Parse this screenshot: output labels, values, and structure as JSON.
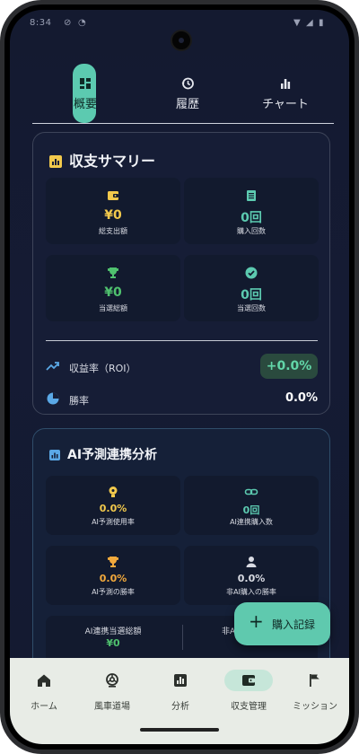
{
  "status": {
    "time": "8:34"
  },
  "tabs": [
    {
      "label": "概要",
      "icon": "dashboard-icon",
      "active": true
    },
    {
      "label": "履歴",
      "icon": "history-icon",
      "active": false
    },
    {
      "label": "チャート",
      "icon": "bar-chart-icon",
      "active": false
    }
  ],
  "summary": {
    "title": "収支サマリー",
    "tiles": [
      {
        "value": "¥0",
        "label": "総支出額",
        "icon": "wallet-icon",
        "color": "#f2c94c"
      },
      {
        "value": "0回",
        "label": "購入回数",
        "icon": "receipt-icon",
        "color": "#5ccab0"
      },
      {
        "value": "¥0",
        "label": "当選総額",
        "icon": "trophy-icon",
        "color": "#4fc16e"
      },
      {
        "value": "0回",
        "label": "当選回数",
        "icon": "check-circle-icon",
        "color": "#5ccab0"
      }
    ],
    "roi": {
      "label": "収益率（ROI）",
      "value": "+0.0%"
    },
    "win_rate": {
      "label": "勝率",
      "value": "0.0%"
    }
  },
  "ai": {
    "title": "AI予測連携分析",
    "tiles": [
      {
        "value": "0.0%",
        "label": "AI予測使用率",
        "icon": "lightbulb-icon",
        "color": "#f2c94c"
      },
      {
        "value": "0回",
        "label": "AI連携購入数",
        "icon": "link-icon",
        "color": "#5ccab0"
      },
      {
        "value": "0.0%",
        "label": "AI予測の勝率",
        "icon": "trophy-icon",
        "color": "#f2a93c"
      },
      {
        "value": "0.0%",
        "label": "非AI購入の勝率",
        "icon": "person-icon",
        "color": "#d9dbe3"
      }
    ],
    "bottom_left": {
      "label": "AI連携当選総額",
      "value": "¥0"
    },
    "bottom_right_partial": "非A"
  },
  "fab": {
    "label": "購入記録"
  },
  "nav": [
    {
      "label": "ホーム",
      "icon": "home-icon",
      "active": false
    },
    {
      "label": "風車道場",
      "icon": "pinwheel-icon",
      "active": false
    },
    {
      "label": "分析",
      "icon": "analytics-icon",
      "active": false
    },
    {
      "label": "収支管理",
      "icon": "wallet-icon",
      "active": true
    },
    {
      "label": "ミッション",
      "icon": "flag-icon",
      "active": false
    }
  ],
  "colors": {
    "accent": "#5ccab0",
    "yellow": "#f2c94c",
    "green": "#4fc16e",
    "orange": "#f2a93c"
  }
}
